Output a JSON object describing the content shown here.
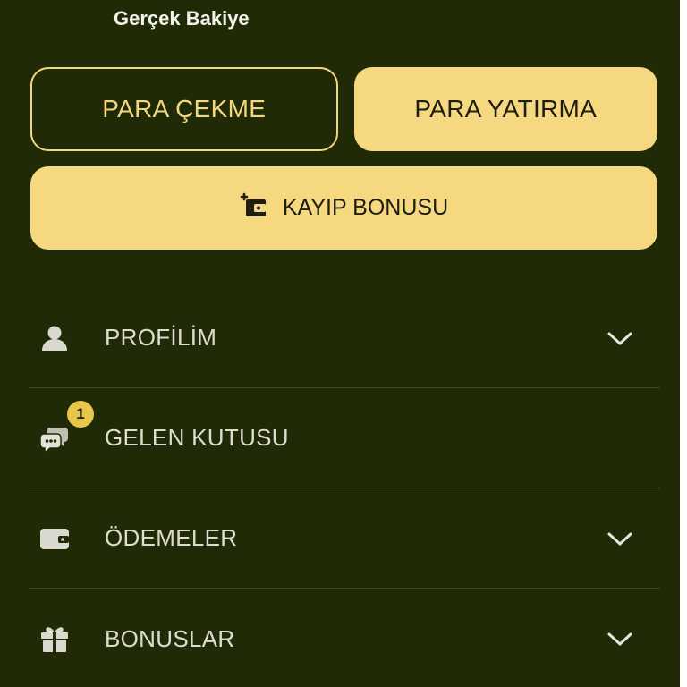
{
  "balance": {
    "label": "Gerçek Bakiye"
  },
  "actions": {
    "withdraw_label": "PARA ÇEKME",
    "deposit_label": "PARA YATIRMA",
    "loss_bonus_label": "KAYIP BONUSU",
    "loss_bonus_icon": "wallet-plus-icon"
  },
  "menu": {
    "items": [
      {
        "label": "PROFİLİM",
        "icon": "user-icon",
        "expandable": true
      },
      {
        "label": "GELEN KUTUSU",
        "icon": "chat-bubbles-icon",
        "badge": "1",
        "expandable": false
      },
      {
        "label": "ÖDEMELER",
        "icon": "wallet-icon",
        "expandable": true
      },
      {
        "label": "BONUSLAR",
        "icon": "gift-icon",
        "expandable": true
      }
    ]
  },
  "colors": {
    "background": "#202a06",
    "accent": "#f6d880",
    "badge": "#e8c54b",
    "divider": "#3f4826"
  }
}
